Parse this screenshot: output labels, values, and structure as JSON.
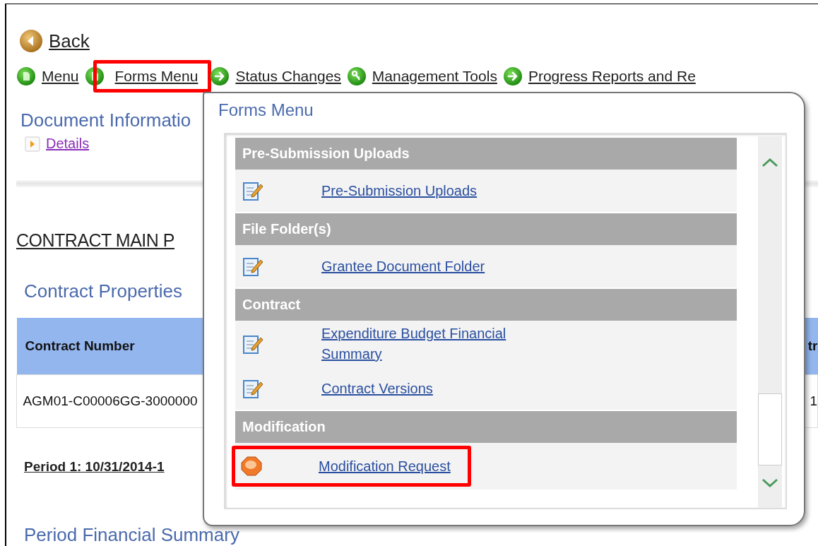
{
  "back": {
    "label": "Back"
  },
  "nav": {
    "items": [
      {
        "label": "Menu",
        "kind": "page",
        "highlighted": false
      },
      {
        "label": "Forms Menu",
        "kind": "page",
        "highlighted": true
      },
      {
        "label": "Status Changes",
        "kind": "arrow",
        "highlighted": false
      },
      {
        "label": "Management Tools",
        "kind": "key",
        "highlighted": false
      },
      {
        "label": "Progress Reports and Re",
        "kind": "arrow",
        "highlighted": false
      }
    ]
  },
  "document_information": {
    "title": "Document Informatio",
    "link": "Details"
  },
  "contract_main_heading": "CONTRACT MAIN P",
  "contract_properties": {
    "title": "Contract Properties",
    "table": {
      "columns": [
        "Contract Number",
        "tr"
      ],
      "rows": [
        [
          "AGM01-C00006GG-3000000",
          "1"
        ]
      ]
    }
  },
  "period_heading": "Period 1: 10/31/2014-1",
  "period_financial_summary": {
    "title": "Period Financial Summary"
  },
  "forms_menu_popup": {
    "title": "Forms Menu",
    "sections": [
      {
        "header": "Pre-Submission Uploads",
        "items": [
          {
            "label": "Pre-Submission Uploads",
            "kind": "form",
            "highlighted": false
          }
        ]
      },
      {
        "header": "File Folder(s)",
        "items": [
          {
            "label": "Grantee Document Folder",
            "kind": "form",
            "highlighted": false
          }
        ]
      },
      {
        "header": "Contract",
        "items": [
          {
            "label": "Expenditure Budget Financial Summary",
            "kind": "form",
            "highlighted": false
          },
          {
            "label": "Contract Versions",
            "kind": "form",
            "highlighted": false
          }
        ]
      },
      {
        "header": "Modification",
        "items": [
          {
            "label": "Modification Request",
            "kind": "request",
            "highlighted": true
          }
        ]
      }
    ]
  }
}
